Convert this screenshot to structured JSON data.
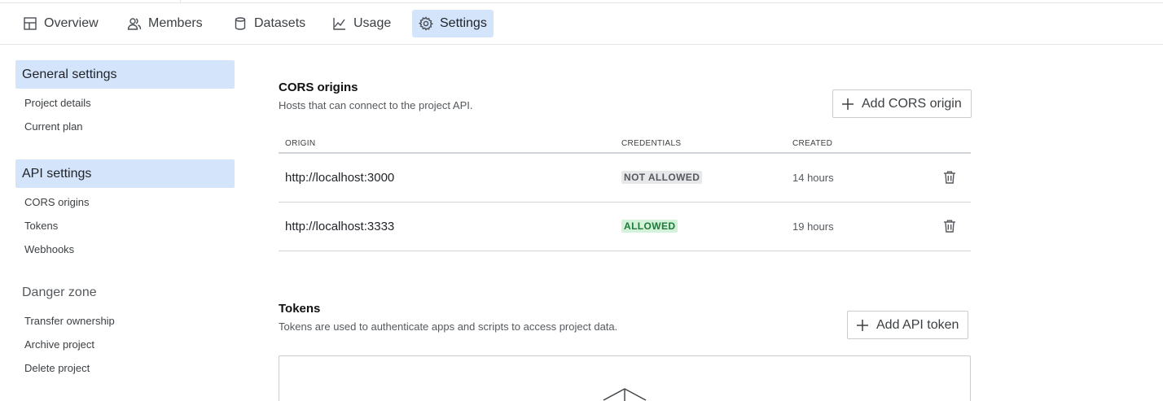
{
  "tabs": [
    {
      "label": "Overview",
      "icon": "layout-icon"
    },
    {
      "label": "Members",
      "icon": "users-icon"
    },
    {
      "label": "Datasets",
      "icon": "database-icon"
    },
    {
      "label": "Usage",
      "icon": "chart-line-icon"
    },
    {
      "label": "Settings",
      "icon": "gear-icon",
      "active": true
    }
  ],
  "sidebar": {
    "general": {
      "title": "General settings",
      "items": [
        "Project details",
        "Current plan"
      ]
    },
    "api": {
      "title": "API settings",
      "items": [
        "CORS origins",
        "Tokens",
        "Webhooks"
      ]
    },
    "danger": {
      "title": "Danger zone",
      "items": [
        "Transfer ownership",
        "Archive project",
        "Delete project"
      ]
    }
  },
  "cors": {
    "title": "CORS origins",
    "subtitle": "Hosts that can connect to the project API.",
    "add_label": "Add CORS origin",
    "columns": [
      "ORIGIN",
      "CREDENTIALS",
      "CREATED"
    ],
    "rows": [
      {
        "origin": "http://localhost:3000",
        "credentials": "NOT ALLOWED",
        "created": "14 hours"
      },
      {
        "origin": "http://localhost:3333",
        "credentials": "ALLOWED",
        "created": "19 hours"
      }
    ]
  },
  "tokens": {
    "title": "Tokens",
    "subtitle": "Tokens are used to authenticate apps and scripts to access project data.",
    "add_label": "Add API token"
  },
  "colors": {
    "accent": "#d4e4fb",
    "allowed_bg": "#d3f2d9",
    "allowed_fg": "#1f7a3a",
    "not_allowed_bg": "#e7e8ea"
  }
}
